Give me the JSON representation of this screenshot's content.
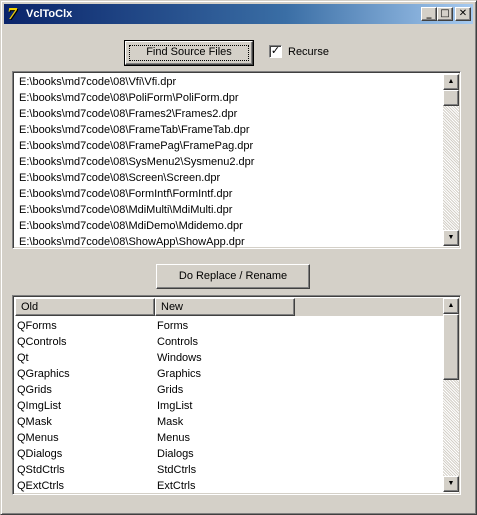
{
  "window": {
    "title": "VclToClx",
    "icon": "delphi-7-icon",
    "buttons": {
      "minimize": "_",
      "maximize": "□",
      "close": "✕"
    }
  },
  "toolbar": {
    "find_label": "Find Source Files",
    "recurse_label": "Recurse",
    "recurse_checked": true,
    "check_glyph": "✓"
  },
  "files": [
    "E:\\books\\md7code\\08\\Vfi\\Vfi.dpr",
    "E:\\books\\md7code\\08\\PoliForm\\PoliForm.dpr",
    "E:\\books\\md7code\\08\\Frames2\\Frames2.dpr",
    "E:\\books\\md7code\\08\\FrameTab\\FrameTab.dpr",
    "E:\\books\\md7code\\08\\FramePag\\FramePag.dpr",
    "E:\\books\\md7code\\08\\SysMenu2\\Sysmenu2.dpr",
    "E:\\books\\md7code\\08\\Screen\\Screen.dpr",
    "E:\\books\\md7code\\08\\FormIntf\\FormIntf.dpr",
    "E:\\books\\md7code\\08\\MdiMulti\\MdiMulti.dpr",
    "E:\\books\\md7code\\08\\MdiDemo\\Mdidemo.dpr",
    "E:\\books\\md7code\\08\\ShowApp\\ShowApp.dpr"
  ],
  "replace_label": "Do Replace / Rename",
  "mapping": {
    "headers": [
      "Old",
      "New"
    ],
    "rows": [
      [
        "QForms",
        "Forms"
      ],
      [
        "QControls",
        "Controls"
      ],
      [
        "Qt",
        "Windows"
      ],
      [
        "QGraphics",
        "Graphics"
      ],
      [
        "QGrids",
        "Grids"
      ],
      [
        "QImgList",
        "ImgList"
      ],
      [
        "QMask",
        "Mask"
      ],
      [
        "QMenus",
        "Menus"
      ],
      [
        "QDialogs",
        "Dialogs"
      ],
      [
        "QStdCtrls",
        "StdCtrls"
      ],
      [
        "QExtCtrls",
        "ExtCtrls"
      ]
    ]
  },
  "scroll": {
    "up_glyph": "▲",
    "down_glyph": "▼"
  },
  "colors": {
    "titlebar_start": "#0a246a",
    "titlebar_end": "#a6caf0",
    "face": "#d4d0c8"
  }
}
